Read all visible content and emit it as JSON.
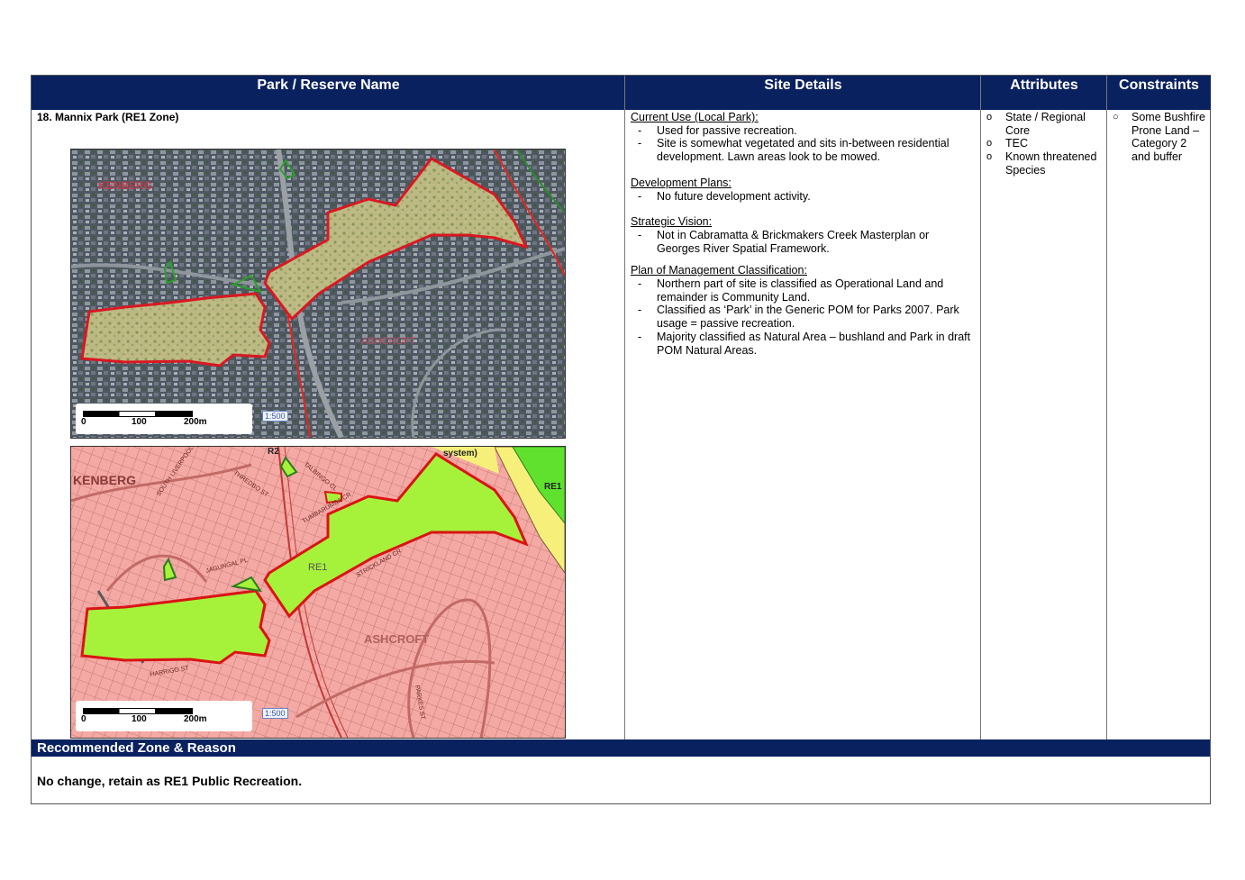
{
  "headers": {
    "name": "Park / Reserve Name",
    "details": "Site Details",
    "attributes": "Attributes",
    "constraints": "Constraints"
  },
  "park": {
    "name": "18. Mannix Park (RE1 Zone)"
  },
  "aerial_map": {
    "label_left": "KENBERG",
    "label_mid": "ASHCROFT",
    "scale": {
      "zero": "0",
      "mid": "100",
      "end": "200m"
    },
    "ratio": "1:500"
  },
  "zoning_map": {
    "label_left": "KENBERG",
    "label_center": "ASHCROFT",
    "zone_label": "RE1",
    "zone_label_right": "RE1",
    "system_label": "system)",
    "r2_label": "R2",
    "streets": {
      "south_liverpool": "SOUTH LIVERPOOL",
      "jagungal": "JAGUNGAL PL",
      "strickland": "STRICKLAND CR",
      "harrigo": "HARRIGO ST",
      "tumbarumba": "TUMBARUMBA CR",
      "thredbo": "THREDBO ST",
      "talbingo": "TALBINGO CL",
      "parkes": "PARKES ST"
    },
    "scale": {
      "zero": "0",
      "mid": "100",
      "end": "200m"
    },
    "ratio": "1:500"
  },
  "site_details": {
    "current_use": {
      "title": "Current Use (Local Park):",
      "items": [
        "Used for passive recreation.",
        "Site is somewhat vegetated and sits in-between residential development. Lawn areas look to be mowed."
      ]
    },
    "development": {
      "title": "Development Plans:",
      "items": [
        "No future development activity."
      ]
    },
    "strategic": {
      "title": "Strategic Vision:",
      "items": [
        "Not in Cabramatta & Brickmakers Creek Masterplan or Georges River Spatial Framework."
      ]
    },
    "pom": {
      "title": "Plan of Management Classification:",
      "items": [
        "Northern part of site is classified as Operational Land and remainder is Community Land.",
        "Classified as ‘Park’ in the Generic POM for Parks 2007. Park usage = passive recreation.",
        "Majority classified as Natural Area – bushland and Park in draft POM Natural Areas."
      ]
    }
  },
  "attributes": [
    "State / Regional Core",
    "TEC",
    "Known threatened Species"
  ],
  "constraints": [
    "Some Bushfire Prone Land – Category 2 and buffer"
  ],
  "recommended": {
    "title": "Recommended Zone & Reason",
    "text": "No change, retain as RE1 Public Recreation."
  },
  "colors": {
    "header_bg": "#0a2160",
    "zone_fill": "#a6f23a",
    "residential_fill": "#f4a9a4",
    "boundary": "#e0141e",
    "aerial_park": "#c9c48a"
  }
}
